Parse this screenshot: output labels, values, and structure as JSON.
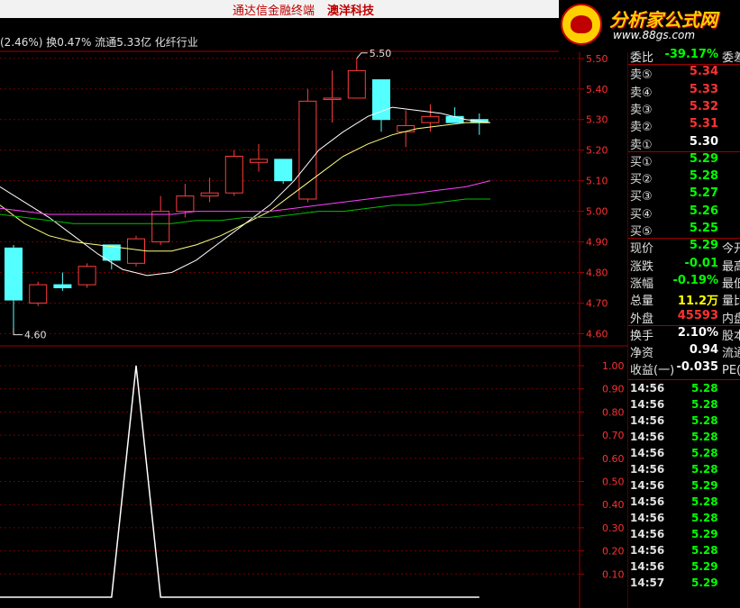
{
  "title_bar": {
    "app": "通达信金融终端",
    "stock": "澳洋科技"
  },
  "logo": {
    "main": "分析家公式网",
    "url": "www.88gs.com"
  },
  "header": {
    "info": "(2.46%) 换0.47% 流通5.33亿 化纤行业"
  },
  "price_axis": [
    "5.50",
    "5.40",
    "5.30",
    "5.20",
    "5.10",
    "5.00",
    "4.90",
    "4.80",
    "4.70",
    "4.60"
  ],
  "price_range": [
    4.56,
    5.52
  ],
  "high_marker": "5.50",
  "low_marker": "4.60",
  "candles": [
    {
      "o": 4.88,
      "h": 4.89,
      "l": 4.62,
      "c": 4.71
    },
    {
      "o": 4.7,
      "h": 4.77,
      "l": 4.69,
      "c": 4.76
    },
    {
      "o": 4.76,
      "h": 4.8,
      "l": 4.74,
      "c": 4.75
    },
    {
      "o": 4.76,
      "h": 4.83,
      "l": 4.75,
      "c": 4.82
    },
    {
      "o": 4.89,
      "h": 4.89,
      "l": 4.81,
      "c": 4.84
    },
    {
      "o": 4.83,
      "h": 4.92,
      "l": 4.82,
      "c": 4.91
    },
    {
      "o": 4.9,
      "h": 5.05,
      "l": 4.89,
      "c": 5.0
    },
    {
      "o": 5.0,
      "h": 5.09,
      "l": 4.98,
      "c": 5.05
    },
    {
      "o": 5.05,
      "h": 5.11,
      "l": 5.03,
      "c": 5.06
    },
    {
      "o": 5.06,
      "h": 5.2,
      "l": 5.05,
      "c": 5.18
    },
    {
      "o": 5.16,
      "h": 5.22,
      "l": 5.13,
      "c": 5.17
    },
    {
      "o": 5.17,
      "h": 5.17,
      "l": 5.09,
      "c": 5.1
    },
    {
      "o": 5.04,
      "h": 5.4,
      "l": 5.03,
      "c": 5.36
    },
    {
      "o": 5.37,
      "h": 5.46,
      "l": 5.29,
      "c": 5.37
    },
    {
      "o": 5.37,
      "h": 5.5,
      "l": 5.37,
      "c": 5.46
    },
    {
      "o": 5.43,
      "h": 5.43,
      "l": 5.26,
      "c": 5.3
    },
    {
      "o": 5.26,
      "h": 5.33,
      "l": 5.21,
      "c": 5.28
    },
    {
      "o": 5.29,
      "h": 5.35,
      "l": 5.26,
      "c": 5.31
    },
    {
      "o": 5.31,
      "h": 5.34,
      "l": 5.29,
      "c": 5.29
    },
    {
      "o": 5.3,
      "h": 5.32,
      "l": 5.25,
      "c": 5.29
    }
  ],
  "ma_lines": [
    {
      "name": "MA-white",
      "color": "#ffffff",
      "values": [
        5.08,
        5.03,
        4.98,
        4.92,
        4.86,
        4.81,
        4.79,
        4.8,
        4.84,
        4.9,
        4.96,
        5.02,
        5.1,
        5.2,
        5.26,
        5.31,
        5.34,
        5.33,
        5.32,
        5.3,
        5.29
      ]
    },
    {
      "name": "MA-yellow",
      "color": "#ffff80",
      "values": [
        5.02,
        4.96,
        4.92,
        4.9,
        4.89,
        4.88,
        4.87,
        4.87,
        4.89,
        4.92,
        4.96,
        5.0,
        5.06,
        5.12,
        5.18,
        5.22,
        5.25,
        5.27,
        5.28,
        5.29,
        5.29
      ]
    },
    {
      "name": "MA-magenta",
      "color": "#ff40ff",
      "values": [
        5.01,
        5.0,
        4.99,
        4.99,
        4.99,
        4.99,
        4.99,
        4.99,
        5.0,
        5.0,
        5.0,
        5.0,
        5.01,
        5.02,
        5.03,
        5.04,
        5.05,
        5.06,
        5.07,
        5.08,
        5.1
      ]
    },
    {
      "name": "MA-green",
      "color": "#00c000",
      "values": [
        4.99,
        4.98,
        4.97,
        4.96,
        4.96,
        4.96,
        4.96,
        4.96,
        4.97,
        4.97,
        4.98,
        4.98,
        4.99,
        5.0,
        5.0,
        5.01,
        5.02,
        5.02,
        5.03,
        5.04,
        5.04
      ]
    }
  ],
  "indicator_axis": [
    "1.00",
    "0.90",
    "0.80",
    "0.70",
    "0.60",
    "0.50",
    "0.40",
    "0.30",
    "0.20",
    "0.10"
  ],
  "indicator_values": [
    0,
    0,
    0,
    0,
    0,
    1,
    0,
    0,
    0,
    0,
    0,
    0,
    0,
    0,
    0,
    0,
    0,
    0,
    0,
    0
  ],
  "quote_rows": [
    {
      "key": "委比",
      "val": "-39.17%",
      "color": "green",
      "extra": "委差"
    },
    {
      "key": "卖⑤",
      "val": "5.34",
      "color": "red",
      "extra": ""
    },
    {
      "key": "卖④",
      "val": "5.33",
      "color": "red",
      "extra": ""
    },
    {
      "key": "卖③",
      "val": "5.32",
      "color": "red",
      "extra": ""
    },
    {
      "key": "卖②",
      "val": "5.31",
      "color": "red",
      "extra": ""
    },
    {
      "key": "卖①",
      "val": "5.30",
      "color": "white",
      "extra": ""
    },
    {
      "key": "买①",
      "val": "5.29",
      "color": "green",
      "extra": ""
    },
    {
      "key": "买②",
      "val": "5.28",
      "color": "green",
      "extra": ""
    },
    {
      "key": "买③",
      "val": "5.27",
      "color": "green",
      "extra": ""
    },
    {
      "key": "买④",
      "val": "5.26",
      "color": "green",
      "extra": ""
    },
    {
      "key": "买⑤",
      "val": "5.25",
      "color": "green",
      "extra": ""
    },
    {
      "key": "现价",
      "val": "5.29",
      "color": "green",
      "extra": "今开"
    },
    {
      "key": "涨跌",
      "val": "-0.01",
      "color": "green",
      "extra": "最高"
    },
    {
      "key": "涨幅",
      "val": "-0.19%",
      "color": "green",
      "extra": "最低"
    },
    {
      "key": "总量",
      "val": "11.2万",
      "color": "yellow",
      "extra": "量比"
    },
    {
      "key": "外盘",
      "val": "45593",
      "color": "red",
      "extra": "内盘"
    },
    {
      "key": "换手",
      "val": "2.10%",
      "color": "white",
      "extra": "股本"
    },
    {
      "key": "净资",
      "val": "0.94",
      "color": "white",
      "extra": "流通"
    },
    {
      "key": "收益(一)",
      "val": "-0.035",
      "color": "white",
      "extra": "PE(动)"
    }
  ],
  "ticks": [
    {
      "t": "14:56",
      "p": "5.28"
    },
    {
      "t": "14:56",
      "p": "5.28"
    },
    {
      "t": "14:56",
      "p": "5.28"
    },
    {
      "t": "14:56",
      "p": "5.28"
    },
    {
      "t": "14:56",
      "p": "5.28"
    },
    {
      "t": "14:56",
      "p": "5.28"
    },
    {
      "t": "14:56",
      "p": "5.29"
    },
    {
      "t": "14:56",
      "p": "5.28"
    },
    {
      "t": "14:56",
      "p": "5.28"
    },
    {
      "t": "14:56",
      "p": "5.29"
    },
    {
      "t": "14:56",
      "p": "5.28"
    },
    {
      "t": "14:56",
      "p": "5.29"
    },
    {
      "t": "14:57",
      "p": "5.29"
    }
  ]
}
